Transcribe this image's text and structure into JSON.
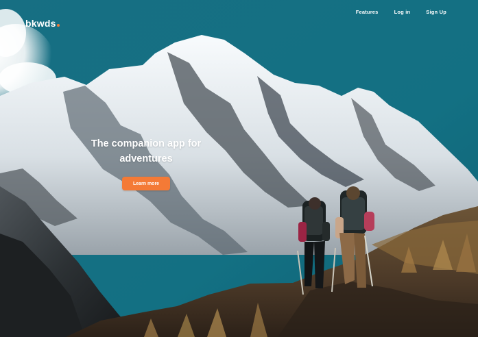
{
  "brand": {
    "name": "bkwds",
    "accent_color": "#f47a36"
  },
  "navigation": {
    "items": [
      {
        "label": "Features"
      },
      {
        "label": "Log in"
      },
      {
        "label": "Sign Up"
      }
    ]
  },
  "hero": {
    "title_lines": [
      "The companion app for",
      "adventures"
    ],
    "cta_label": "Learn more",
    "background_colors": {
      "sky": "#137083",
      "snow": "#e8edf0",
      "rock": "#1f2325",
      "trail": "#5a4630"
    }
  }
}
